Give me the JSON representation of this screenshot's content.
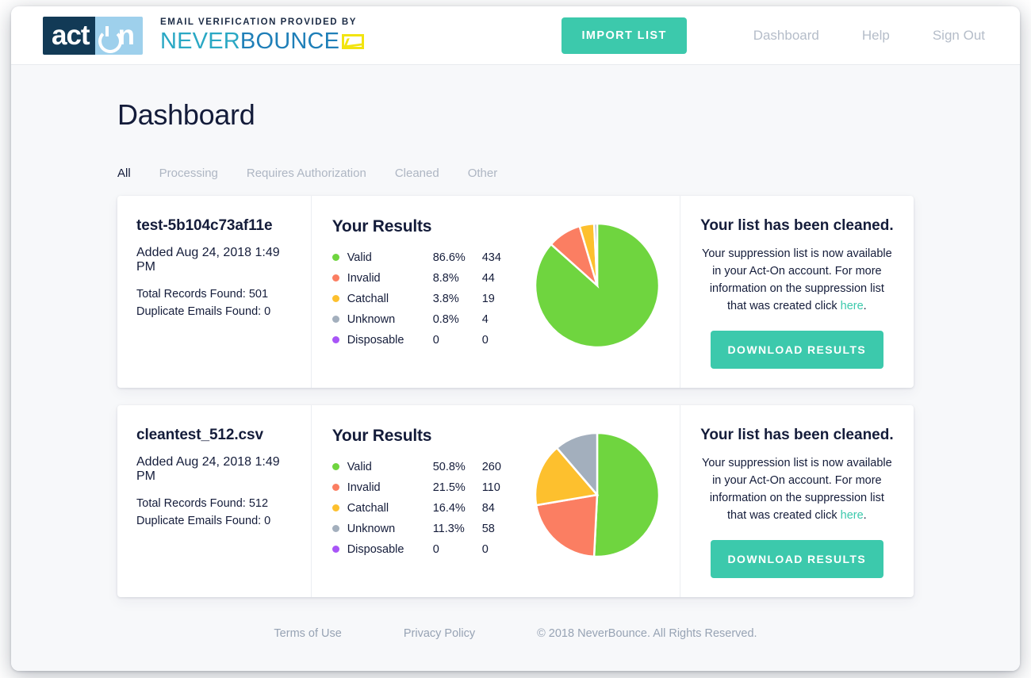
{
  "brand": {
    "acton_dark": "act",
    "acton_light": "n",
    "kicker": "EMAIL VERIFICATION PROVIDED BY",
    "name_a": "NEVER",
    "name_b": "BOUNCE",
    "envelope_icon": "envelope-icon"
  },
  "nav": {
    "import_label": "IMPORT LIST",
    "links": [
      {
        "label": "Dashboard",
        "name": "nav-dashboard"
      },
      {
        "label": "Help",
        "name": "nav-help"
      },
      {
        "label": "Sign Out",
        "name": "nav-signout"
      }
    ]
  },
  "page": {
    "title": "Dashboard"
  },
  "tabs": [
    {
      "label": "All",
      "active": true
    },
    {
      "label": "Processing",
      "active": false
    },
    {
      "label": "Requires Authorization",
      "active": false
    },
    {
      "label": "Cleaned",
      "active": false
    },
    {
      "label": "Other",
      "active": false
    }
  ],
  "colors": {
    "accent_teal": "#3cc9ac",
    "valid": "#6fd53f",
    "invalid": "#fb7e62",
    "catchall": "#fdc02e",
    "unknown": "#a3afbd",
    "disposable": "#a855f7",
    "title_navy": "#141c3a",
    "muted": "#aeb6c3",
    "page_bg": "#f7f8fa"
  },
  "results_header": "Your Results",
  "status": {
    "heading": "Your list has been cleaned.",
    "body_before": "Your suppression list is now available in your Act-On account. For more information on the suppression list that was created click ",
    "link_label": "here",
    "body_after": ".",
    "download_label": "DOWNLOAD RESULTS"
  },
  "lists": [
    {
      "name": "test-5b104c73af11e",
      "added": "Added Aug 24, 2018 1:49 PM",
      "total_records": "Total Records Found: 501",
      "duplicates": "Duplicate Emails Found: 0",
      "legend": [
        {
          "label": "Valid",
          "pct": "86.6%",
          "count": "434",
          "color": "#6fd53f"
        },
        {
          "label": "Invalid",
          "pct": "8.8%",
          "count": "44",
          "color": "#fb7e62"
        },
        {
          "label": "Catchall",
          "pct": "3.8%",
          "count": "19",
          "color": "#fdc02e"
        },
        {
          "label": "Unknown",
          "pct": "0.8%",
          "count": "4",
          "color": "#a3afbd"
        },
        {
          "label": "Disposable",
          "pct": "0",
          "count": "0",
          "color": "#a855f7"
        }
      ]
    },
    {
      "name": "cleantest_512.csv",
      "added": "Added Aug 24, 2018 1:49 PM",
      "total_records": "Total Records Found: 512",
      "duplicates": "Duplicate Emails Found: 0",
      "legend": [
        {
          "label": "Valid",
          "pct": "50.8%",
          "count": "260",
          "color": "#6fd53f"
        },
        {
          "label": "Invalid",
          "pct": "21.5%",
          "count": "110",
          "color": "#fb7e62"
        },
        {
          "label": "Catchall",
          "pct": "16.4%",
          "count": "84",
          "color": "#fdc02e"
        },
        {
          "label": "Unknown",
          "pct": "11.3%",
          "count": "58",
          "color": "#a3afbd"
        },
        {
          "label": "Disposable",
          "pct": "0",
          "count": "0",
          "color": "#a855f7"
        }
      ]
    }
  ],
  "footer": {
    "terms": "Terms of Use",
    "privacy": "Privacy Policy",
    "copyright": "© 2018 NeverBounce. All Rights Reserved."
  },
  "chart_data": [
    {
      "type": "pie",
      "title": "test-5b104c73af11e email verification results",
      "labels": [
        "Valid",
        "Invalid",
        "Catchall",
        "Unknown",
        "Disposable"
      ],
      "values": [
        86.6,
        8.8,
        3.8,
        0.8,
        0
      ],
      "counts": [
        434,
        44,
        19,
        4,
        0
      ],
      "total": 501,
      "colors": [
        "#6fd53f",
        "#fb7e62",
        "#fdc02e",
        "#a3afbd",
        "#a855f7"
      ],
      "start_angle_deg": 0,
      "direction": "clockwise",
      "legend_position": "left",
      "radius_px": 78
    },
    {
      "type": "pie",
      "title": "cleantest_512.csv email verification results",
      "labels": [
        "Valid",
        "Invalid",
        "Catchall",
        "Unknown",
        "Disposable"
      ],
      "values": [
        50.8,
        21.5,
        16.4,
        11.3,
        0
      ],
      "counts": [
        260,
        110,
        84,
        58,
        0
      ],
      "total": 512,
      "colors": [
        "#6fd53f",
        "#fb7e62",
        "#fdc02e",
        "#a3afbd",
        "#a855f7"
      ],
      "start_angle_deg": 0,
      "direction": "clockwise",
      "legend_position": "left",
      "radius_px": 78
    }
  ]
}
